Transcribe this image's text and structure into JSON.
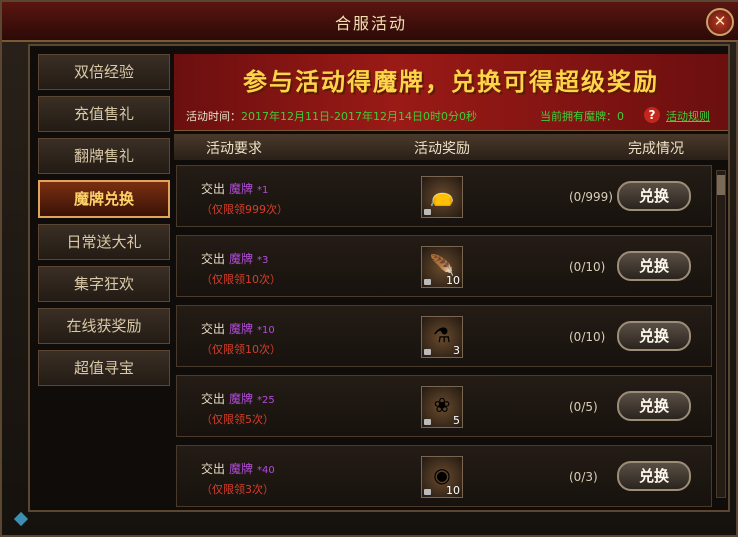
{
  "window": {
    "title": "合服活动",
    "close": "✕"
  },
  "sidebar": {
    "items": [
      {
        "label": "双倍经验"
      },
      {
        "label": "充值售礼"
      },
      {
        "label": "翻牌售礼"
      },
      {
        "label": "魔牌兑换",
        "active": true
      },
      {
        "label": "日常送大礼"
      },
      {
        "label": "集字狂欢"
      },
      {
        "label": "在线获奖励"
      },
      {
        "label": "超值寻宝"
      }
    ]
  },
  "banner": {
    "title": "参与活动得魔牌，兑换可得超级奖励",
    "time_label": "活动时间：",
    "time_value": "2017年12月11日-2017年12月14日0时0分0秒",
    "count_text": "当前拥有魔牌：0",
    "help_icon": "?",
    "rules_link": "活动规则"
  },
  "table": {
    "headers": [
      "活动要求",
      "活动奖励",
      "完成情况"
    ]
  },
  "rows": [
    {
      "prefix": "交出",
      "item": "魔牌",
      "qty": "*1",
      "limit": "（仅限领999次）",
      "reward_icon": "bag-icon",
      "count": "",
      "progress": "(0/999)",
      "button": "兑换"
    },
    {
      "prefix": "交出",
      "item": "魔牌",
      "qty": "*3",
      "limit": "（仅限领10次）",
      "reward_icon": "wing-icon",
      "count": "10",
      "progress": "(0/10)",
      "button": "兑换"
    },
    {
      "prefix": "交出",
      "item": "魔牌",
      "qty": "*10",
      "limit": "（仅限领10次）",
      "reward_icon": "potion-icon",
      "count": "3",
      "progress": "(0/10)",
      "button": "兑换"
    },
    {
      "prefix": "交出",
      "item": "魔牌",
      "qty": "*25",
      "limit": "（仅限领5次）",
      "reward_icon": "lotus-icon",
      "count": "5",
      "progress": "(0/5)",
      "button": "兑换"
    },
    {
      "prefix": "交出",
      "item": "魔牌",
      "qty": "*40",
      "limit": "（仅限领3次）",
      "reward_icon": "orb-icon",
      "count": "10",
      "progress": "(0/3)",
      "button": "兑换"
    }
  ],
  "colors": {
    "accent": "#ffd44a",
    "green": "#3ecf3a",
    "purple": "#b24cd8",
    "red": "#d63e2a"
  }
}
